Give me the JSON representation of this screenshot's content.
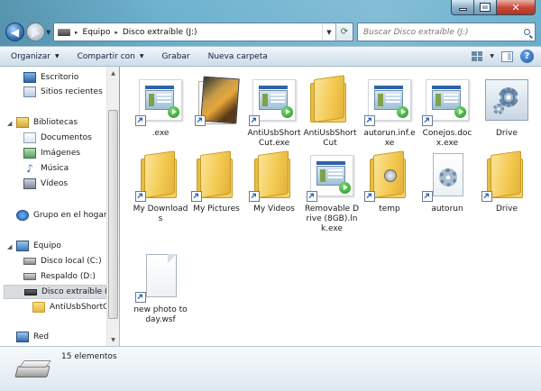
{
  "window": {
    "controls": {
      "minimize": "minimize",
      "maximize": "maximize",
      "close": "✕"
    }
  },
  "address": {
    "crumbs": [
      "Equipo",
      "Disco extraíble (J:)"
    ],
    "separator": "▸"
  },
  "search": {
    "placeholder": "Buscar Disco extraíble (J:)"
  },
  "toolbar": {
    "organize": "Organizar",
    "share": "Compartir con",
    "burn": "Grabar",
    "new_folder": "Nueva carpeta"
  },
  "navpane": {
    "favorites": [
      {
        "label": "Escritorio",
        "icon": "desktop-icon"
      },
      {
        "label": "Sitios recientes",
        "icon": "recent-places-icon"
      }
    ],
    "libraries_label": "Bibliotecas",
    "libraries": [
      {
        "label": "Documentos",
        "icon": "documents-icon"
      },
      {
        "label": "Imágenes",
        "icon": "pictures-icon"
      },
      {
        "label": "Música",
        "icon": "music-icon"
      },
      {
        "label": "Vídeos",
        "icon": "videos-icon"
      }
    ],
    "homegroup": "Grupo en el hogar",
    "computer_label": "Equipo",
    "drives": [
      {
        "label": "Disco local (C:)"
      },
      {
        "label": "Respaldo (D:)"
      },
      {
        "label": "Disco extraíble (J:)"
      }
    ],
    "subfolder": "AntiUsbShortC",
    "network": "Red"
  },
  "files": [
    {
      "name": ".exe",
      "type": "exe",
      "shortcut": true
    },
    {
      "name": "",
      "type": "image",
      "shortcut": true
    },
    {
      "name": "AntiUsbShortCut.exe",
      "type": "exe",
      "shortcut": true
    },
    {
      "name": "AntiUsbShortCut",
      "type": "folder",
      "shortcut": false
    },
    {
      "name": "autorun.inf.exe",
      "type": "exe",
      "shortcut": true
    },
    {
      "name": "Conejos.docx.exe",
      "type": "exe",
      "shortcut": true
    },
    {
      "name": "Drive",
      "type": "setup",
      "shortcut": false
    },
    {
      "name": "My Downloads",
      "type": "folder",
      "shortcut": true
    },
    {
      "name": "My Pictures",
      "type": "folder",
      "shortcut": true
    },
    {
      "name": "My Videos",
      "type": "folder",
      "shortcut": true
    },
    {
      "name": "Removable Drive (8GB).lnk.exe",
      "type": "exe",
      "shortcut": true
    },
    {
      "name": "temp",
      "type": "music-folder",
      "shortcut": true
    },
    {
      "name": "autorun",
      "type": "gear-doc",
      "shortcut": true
    },
    {
      "name": "Drive",
      "type": "folder",
      "shortcut": true
    },
    {
      "name": "new photo today.wsf",
      "type": "doc",
      "shortcut": true
    }
  ],
  "status": {
    "count": "15 elementos"
  }
}
